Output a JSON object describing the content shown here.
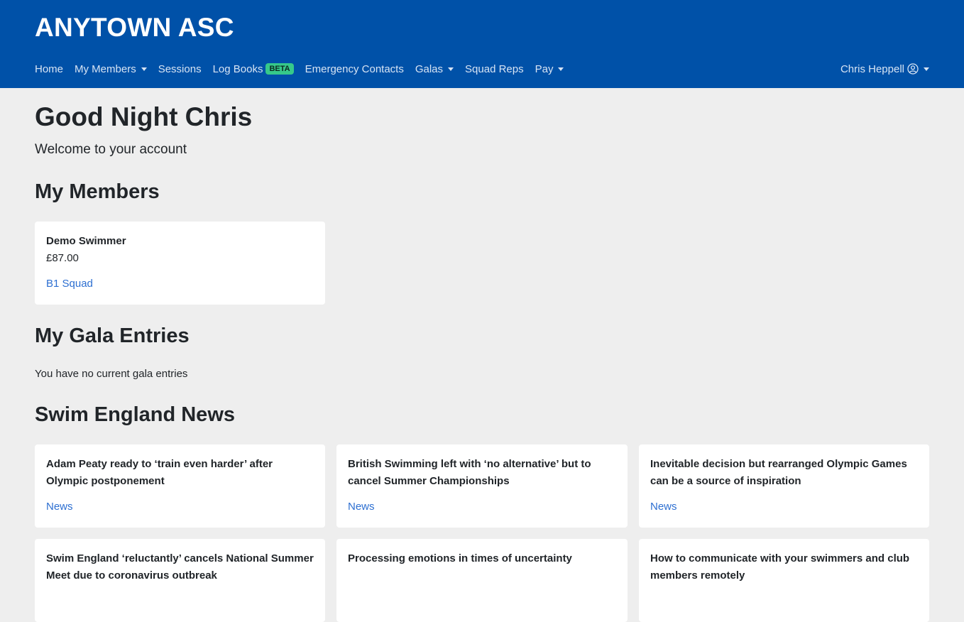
{
  "header": {
    "brand": "ANYTOWN ASC",
    "nav": [
      {
        "label": "Home"
      },
      {
        "label": "My Members"
      },
      {
        "label": "Sessions"
      },
      {
        "label": "Log Books",
        "badge": "BETA"
      },
      {
        "label": "Emergency Contacts"
      },
      {
        "label": "Galas"
      },
      {
        "label": "Squad Reps"
      },
      {
        "label": "Pay"
      }
    ],
    "user_name": "Chris Heppell"
  },
  "main": {
    "greeting": "Good Night Chris",
    "welcome": "Welcome to your account",
    "members_heading": "My Members",
    "members": [
      {
        "name": "Demo Swimmer",
        "amount": "£87.00",
        "squad": "B1 Squad"
      }
    ],
    "gala_heading": "My Gala Entries",
    "gala_empty": "You have no current gala entries",
    "news_heading": "Swim England News",
    "news": [
      {
        "title": "Adam Peaty ready to ‘train even harder’ after Olympic postponement",
        "category": "News"
      },
      {
        "title": "British Swimming left with ‘no alternative’ but to cancel Summer Championships",
        "category": "News"
      },
      {
        "title": "Inevitable decision but rearranged Olympic Games can be a source of inspiration",
        "category": "News"
      },
      {
        "title": "Swim England ‘reluctantly’ cancels National Summer Meet due to coronavirus outbreak"
      },
      {
        "title": "Processing emotions in times of uncertainty"
      },
      {
        "title": "How to communicate with your swimmers and club members remotely"
      }
    ]
  },
  "colors": {
    "header_bg": "#0051a8",
    "page_bg": "#eeeeee",
    "link": "#2d6fd1",
    "badge_bg": "#36c98a"
  }
}
